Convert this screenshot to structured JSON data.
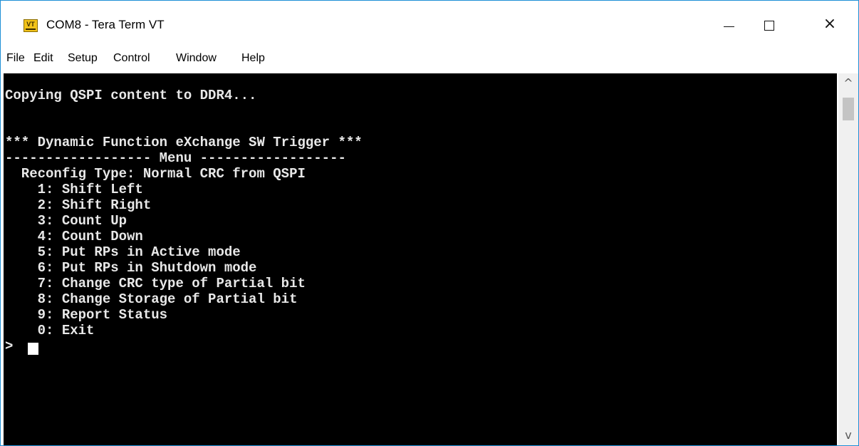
{
  "window": {
    "title": "COM8 - Tera Term VT",
    "icon": "tera-term-vt-icon",
    "controls": {
      "minimize": "minimize-icon",
      "maximize": "maximize-icon",
      "close": "×"
    }
  },
  "menubar": {
    "items": [
      "File",
      "Edit",
      "Setup",
      "Control",
      "Window",
      "Help"
    ]
  },
  "terminal": {
    "lines": [
      "Copying QSPI content to DDR4...",
      "",
      "",
      "*** Dynamic Function eXchange SW Trigger ***",
      "------------------ Menu ------------------",
      "  Reconfig Type: Normal CRC from QSPI",
      "    1: Shift Left",
      "    2: Shift Right",
      "    3: Count Up",
      "    4: Count Down",
      "    5: Put RPs in Active mode",
      "    6: Put RPs in Shutdown mode",
      "    7: Change CRC type of Partial bit",
      "    8: Change Storage of Partial bit",
      "    9: Report Status",
      "    0: Exit",
      "> "
    ]
  },
  "scrollbar": {
    "up": "^",
    "down": "v"
  },
  "colors": {
    "terminal_background": "#000000",
    "terminal_text": "#e8e8e8",
    "window_border": "#1e8fd6"
  }
}
